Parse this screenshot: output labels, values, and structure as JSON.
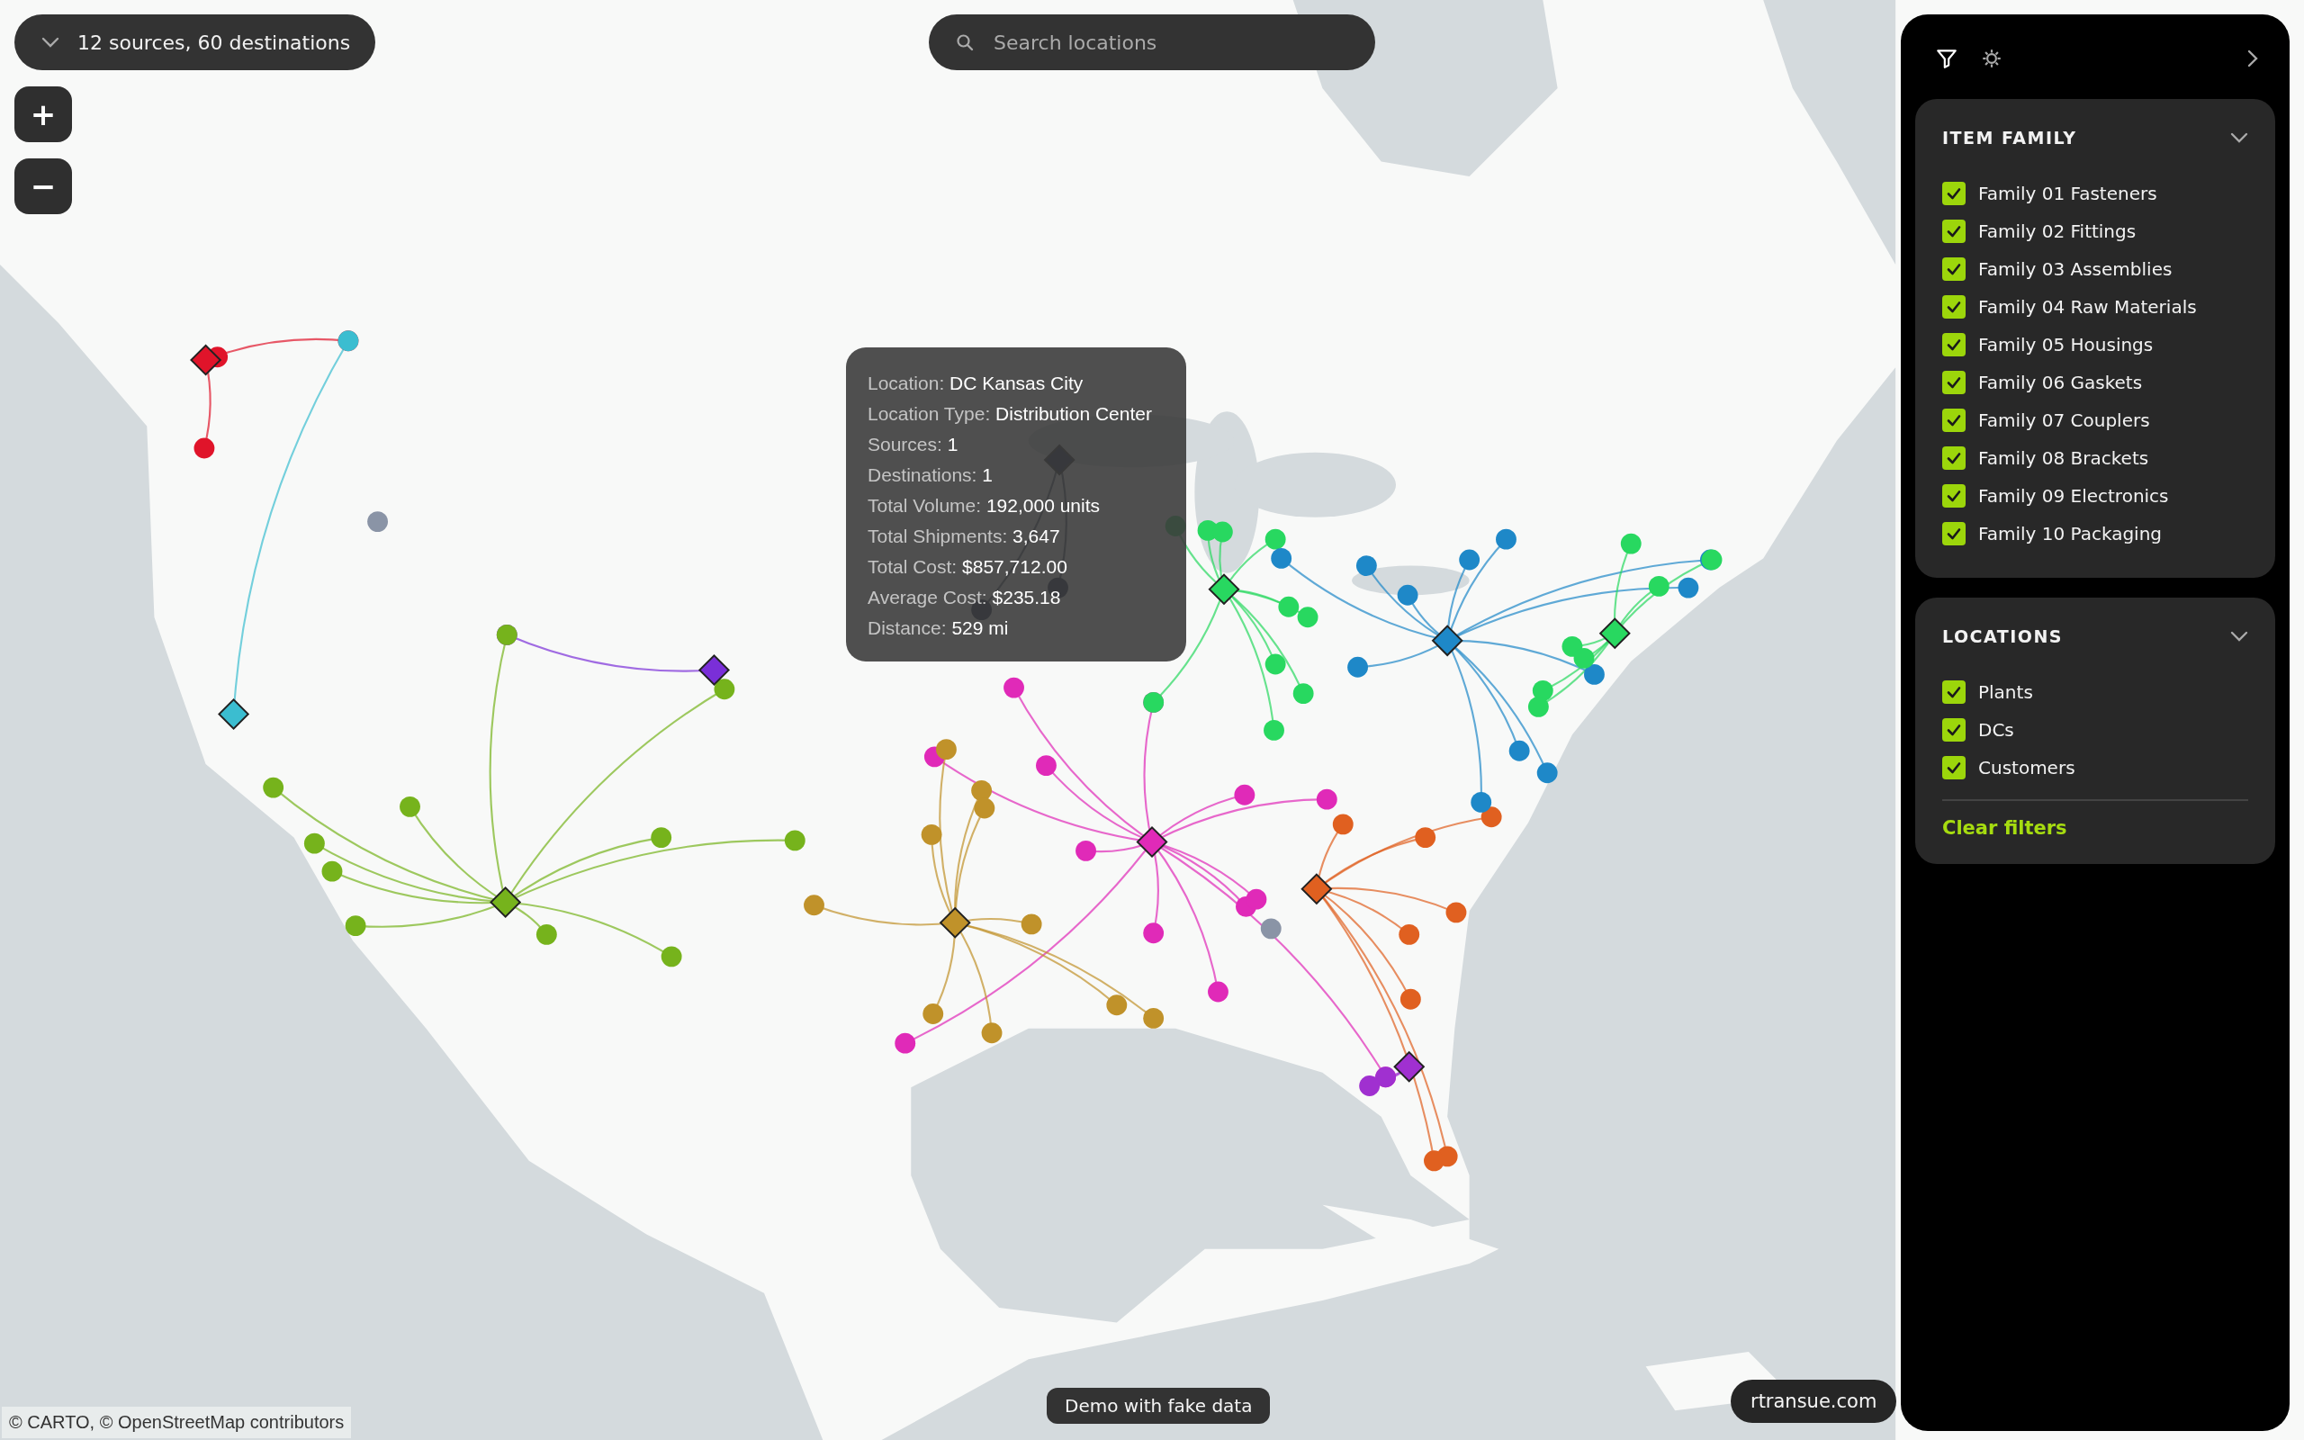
{
  "summary": {
    "label": "12 sources, 60 destinations",
    "expanded": false
  },
  "zoom_controls": [
    "+",
    "−"
  ],
  "search": {
    "placeholder": "Search locations"
  },
  "tooltip": {
    "rows": [
      {
        "label": "Location:",
        "value": "DC Kansas City"
      },
      {
        "label": "Location Type:",
        "value": "Distribution Center"
      },
      {
        "label": "Sources:",
        "value": "1"
      },
      {
        "label": "Destinations:",
        "value": "1"
      },
      {
        "label": "Total Volume:",
        "value": "192,000 units"
      },
      {
        "label": "Total Shipments:",
        "value": "3,647"
      },
      {
        "label": "Total Cost:",
        "value": "$857,712.00"
      },
      {
        "label": "Average Cost:",
        "value": "$235.18"
      },
      {
        "label": "Distance:",
        "value": "529 mi"
      }
    ]
  },
  "panel": {
    "tabs": [
      {
        "kind": "filter",
        "selected": true
      },
      {
        "kind": "settings",
        "selected": false
      }
    ],
    "sections": [
      {
        "title": "ITEM FAMILY",
        "expanded": true,
        "items": [
          {
            "label": "Family 01 Fasteners",
            "checked": true
          },
          {
            "label": "Family 02 Fittings",
            "checked": true
          },
          {
            "label": "Family 03 Assemblies",
            "checked": true
          },
          {
            "label": "Family 04 Raw Materials",
            "checked": true
          },
          {
            "label": "Family 05 Housings",
            "checked": true
          },
          {
            "label": "Family 06 Gaskets",
            "checked": true
          },
          {
            "label": "Family 07 Couplers",
            "checked": true
          },
          {
            "label": "Family 08 Brackets",
            "checked": true
          },
          {
            "label": "Family 09 Electronics",
            "checked": true
          },
          {
            "label": "Family 10 Packaging",
            "checked": true
          }
        ]
      },
      {
        "title": "LOCATIONS",
        "expanded": true,
        "items": [
          {
            "label": "Plants",
            "checked": true
          },
          {
            "label": "DCs",
            "checked": true
          },
          {
            "label": "Customers",
            "checked": true
          }
        ]
      }
    ],
    "clear_filters": "Clear filters"
  },
  "attribution": "© CARTO, © OpenStreetMap contributors",
  "demo_badge": "Demo with fake data",
  "site_link": "rtransue.com"
}
